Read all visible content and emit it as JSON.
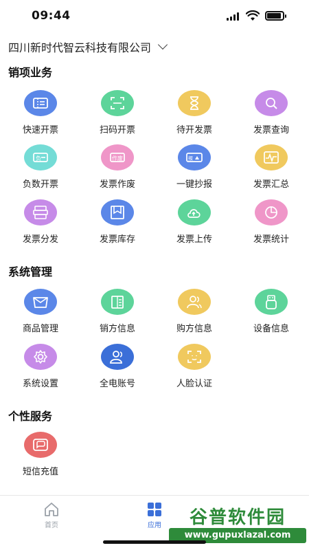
{
  "status": {
    "time": "09:44"
  },
  "header": {
    "company_name": "四川新时代智云科技有限公司"
  },
  "sections": [
    {
      "title": "销项业务",
      "items": [
        {
          "label": "快速开票",
          "icon": "ticket-icon",
          "color": "#5b87e8"
        },
        {
          "label": "扫码开票",
          "icon": "scan-icon",
          "color": "#5dd49a"
        },
        {
          "label": "待开发票",
          "icon": "hourglass-icon",
          "color": "#f0c95e"
        },
        {
          "label": "发票查询",
          "icon": "search-icon",
          "color": "#c68be8"
        },
        {
          "label": "负数开票",
          "icon": "negative-ticket-icon",
          "color": "#74dcd6"
        },
        {
          "label": "发票作废",
          "icon": "void-ticket-icon",
          "color": "#ef96c8"
        },
        {
          "label": "一键抄报",
          "icon": "report-icon",
          "color": "#5b87e8"
        },
        {
          "label": "发票汇总",
          "icon": "summary-icon",
          "color": "#f0c95e"
        },
        {
          "label": "发票分发",
          "icon": "distribute-icon",
          "color": "#c68be8"
        },
        {
          "label": "发票库存",
          "icon": "inventory-icon",
          "color": "#5b87e8"
        },
        {
          "label": "发票上传",
          "icon": "cloud-upload-icon",
          "color": "#5dd49a"
        },
        {
          "label": "发票统计",
          "icon": "pie-chart-icon",
          "color": "#ef96c8"
        }
      ]
    },
    {
      "title": "系统管理",
      "items": [
        {
          "label": "商品管理",
          "icon": "box-icon",
          "color": "#5b87e8"
        },
        {
          "label": "销方信息",
          "icon": "building-icon",
          "color": "#5dd49a"
        },
        {
          "label": "购方信息",
          "icon": "users-icon",
          "color": "#f0c95e"
        },
        {
          "label": "设备信息",
          "icon": "usb-device-icon",
          "color": "#5dd49a"
        },
        {
          "label": "系统设置",
          "icon": "gear-icon",
          "color": "#c68be8"
        },
        {
          "label": "全电账号",
          "icon": "account-icon",
          "color": "#3b6fd8"
        },
        {
          "label": "人脸认证",
          "icon": "face-scan-icon",
          "color": "#f0c95e"
        }
      ]
    },
    {
      "title": "个性服务",
      "items": [
        {
          "label": "短信充值",
          "icon": "message-icon",
          "color": "#e86b6b"
        }
      ]
    }
  ],
  "tabbar": {
    "tabs": [
      {
        "label": "首页",
        "icon": "home-icon",
        "active": false
      },
      {
        "label": "应用",
        "icon": "apps-icon",
        "active": true
      }
    ],
    "active_color": "#3b6fd8",
    "inactive_color": "#9aa0a8"
  },
  "watermark": {
    "title": "谷普软件园",
    "url": "www.gupuxlazal.com"
  }
}
